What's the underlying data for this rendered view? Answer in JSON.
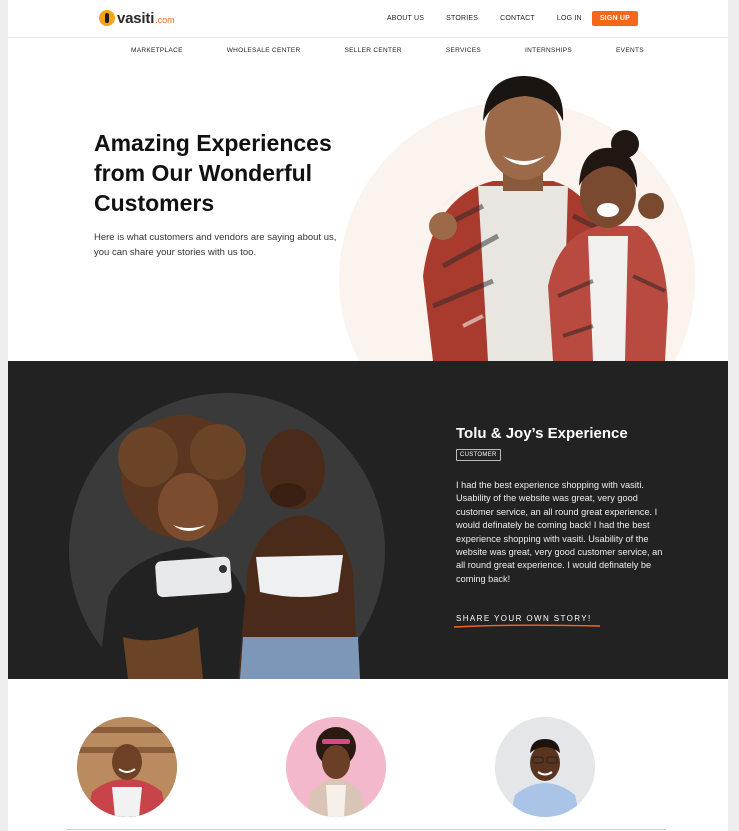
{
  "brand": {
    "name": "vasiti",
    "tld": ".com"
  },
  "topnav": {
    "items": [
      "ABOUT US",
      "STORIES",
      "CONTACT",
      "LOG IN"
    ],
    "signup": "SIGN UP"
  },
  "subnav": {
    "items": [
      "MARKETPLACE",
      "WHOLESALE CENTER",
      "SELLER CENTER",
      "SERVICES",
      "INTERNSHIPS",
      "EVENTS"
    ]
  },
  "hero": {
    "title": "Amazing Experiences from Our Wonderful Customers",
    "description": "Here is what customers and vendors are saying about us, you can share your stories with us too."
  },
  "testimonial": {
    "title": "Tolu & Joy’s Experience",
    "badge": "CUSTOMER",
    "body": "I had the best experience shopping with vasiti. Usability of the website was great, very good customer service, an all round great experience. I would definately be coming back! I had the best experience shopping with vasiti. Usability of the website was great, very good customer service, an all round great experience. I would definately be coming back!",
    "cta": "SHARE YOUR OWN STORY!"
  },
  "colors": {
    "accent": "#f6671a",
    "dark_section": "#222222",
    "hero_circle": "#fbf3ee"
  }
}
